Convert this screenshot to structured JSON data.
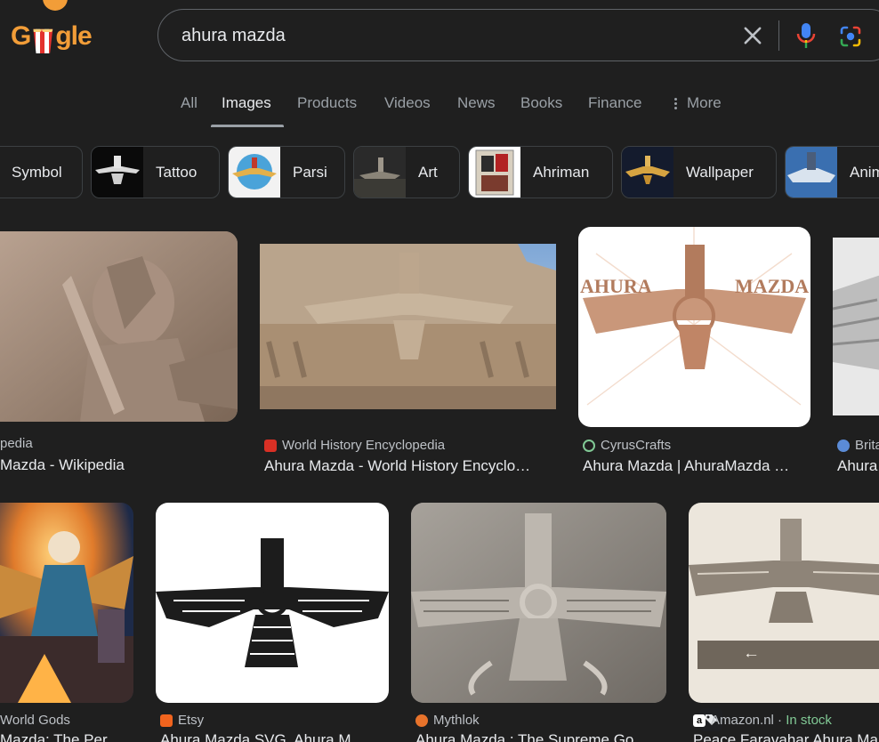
{
  "logo": {
    "letters": [
      "G",
      "g",
      "l",
      "e"
    ]
  },
  "search": {
    "query": "ahura mazda"
  },
  "tabs": [
    "All",
    "Images",
    "Products",
    "Videos",
    "News",
    "Books",
    "Finance",
    "More"
  ],
  "chips": [
    "Symbol",
    "Tattoo",
    "Parsi",
    "Art",
    "Ahriman",
    "Wallpaper",
    "Anim"
  ],
  "results": [
    {
      "source": "pedia",
      "title": "Mazda - Wikipedia"
    },
    {
      "source": "World History Encyclopedia",
      "title": "Ahura Mazda - World History Encyclo…"
    },
    {
      "source": "CyrusCrafts",
      "title": "Ahura Mazda | AhuraMazda …"
    },
    {
      "source": "Brita",
      "title": "Ahura"
    },
    {
      "source": "World Gods",
      "title": "Mazda: The Per"
    },
    {
      "source": "Etsy",
      "title": "Ahura Mazda SVG, Ahura M"
    },
    {
      "source": "Mythlok",
      "title": "Ahura Mazda : The Supreme Go"
    },
    {
      "source": "Amazon.nl",
      "separator": "·",
      "stock": "In stock",
      "title": "Peace Faravahar Ahura Ma"
    }
  ],
  "image_texts": {
    "cyruscrafts_left": "AHURA",
    "cyruscrafts_right": "MAZDA"
  },
  "colors": {
    "background": "#1f1f1f",
    "text": "#e8eaed",
    "muted": "#9aa0a6",
    "border": "#3c4043",
    "instock": "#81c995"
  }
}
